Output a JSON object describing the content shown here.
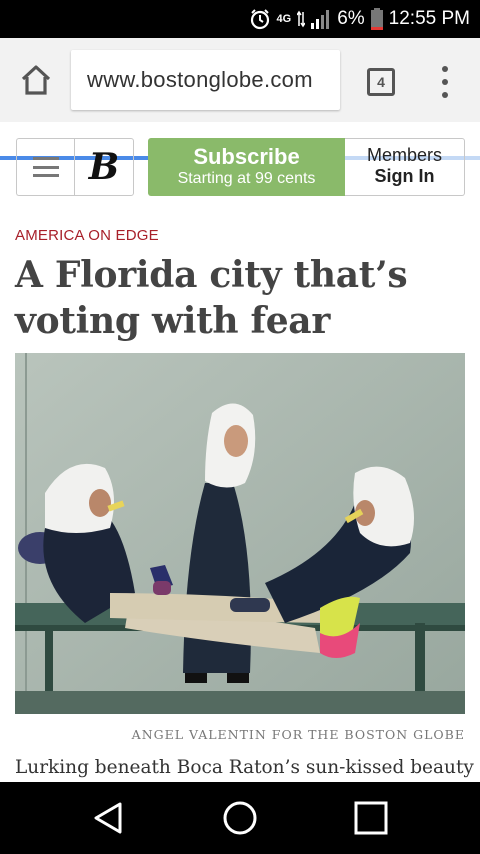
{
  "status_bar": {
    "network": "4G",
    "battery": "6%",
    "time": "12:55 PM",
    "icons": [
      "alarm-icon",
      "network-arrows-icon",
      "signal-icon",
      "battery-low-icon"
    ]
  },
  "browser": {
    "url": "www.bostonglobe.com",
    "tab_count": "4",
    "home_icon": "home-icon",
    "menu_icon": "overflow-menu-icon",
    "load_progress": 0.53,
    "progress_color": "#4a8ae8"
  },
  "site_header": {
    "logo_letter": "B",
    "logo_alt": "Boston Globe logo",
    "subscribe_label": "Subscribe",
    "subscribe_sub": "Starting at 99 cents",
    "members_label": "Members",
    "signin_label": "Sign In",
    "subscribe_color": "#8aba6a"
  },
  "article": {
    "kicker": "AMERICA ON EDGE",
    "kicker_color": "#a8202a",
    "headline": "A Florida city that’s voting with fear",
    "photo_credit": "ANGEL VALENTIN FOR THE BOSTON GLOBE",
    "lede": "Lurking beneath Boca Raton’s sun-kissed beauty"
  },
  "nav_bar": {
    "back_icon": "back-triangle-icon",
    "home_icon": "home-circle-icon",
    "recents_icon": "recents-square-icon"
  }
}
